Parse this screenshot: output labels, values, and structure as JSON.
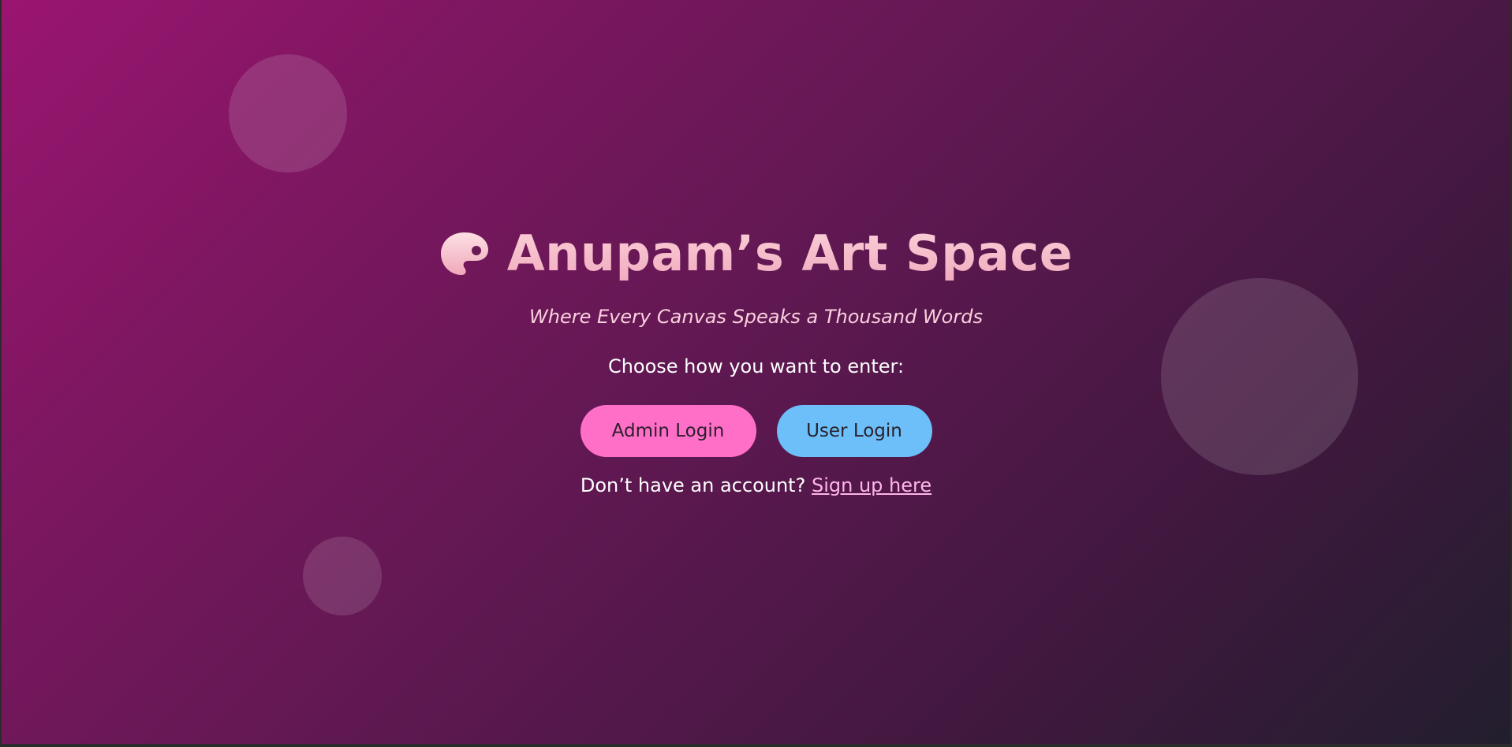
{
  "app": {
    "title": "Anupam’s Art Space",
    "tagline": "Where Every Canvas Speaks a Thousand Words",
    "title_icon": "palette-icon"
  },
  "login": {
    "prompt": "Choose how you want to enter:",
    "admin_button_label": "Admin Login",
    "user_button_label": "User Login"
  },
  "signup": {
    "text": "Don’t have an account?",
    "link_label": "Sign up here"
  },
  "colors": {
    "background_start": "#9a1570",
    "background_end": "#221e2e",
    "title": "#f7bfcc",
    "admin_button": "#ff6fc7",
    "user_button": "#6cbff8",
    "link": "#ffb6e6"
  }
}
